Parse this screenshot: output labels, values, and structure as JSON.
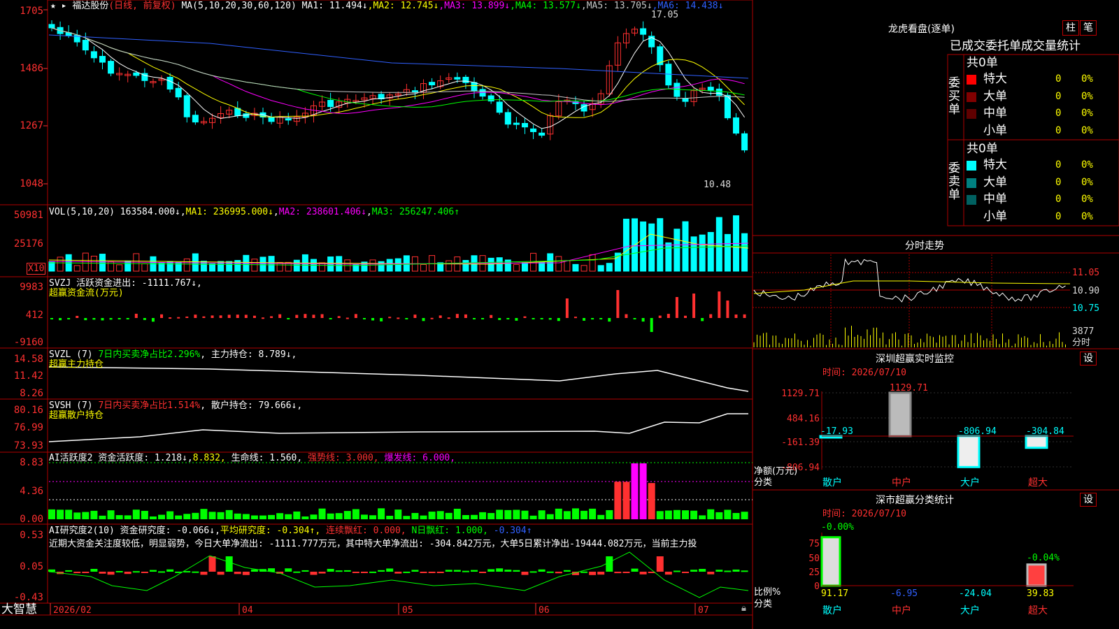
{
  "app": {
    "logo": "大智慧"
  },
  "main": {
    "stock": "福达股份",
    "period": "(日线, 前复权)",
    "ma_label": "MA(5,10,20,30,60,120)",
    "ma": [
      {
        "name": "MA1:",
        "value": "11.494↓",
        "color": "#ffffff"
      },
      {
        "name": "MA2:",
        "value": "12.745↓",
        "color": "#ffff00"
      },
      {
        "name": "MA3:",
        "value": "13.899↓",
        "color": "#ff00ff"
      },
      {
        "name": "MA4:",
        "value": "13.577↓",
        "color": "#00ff00"
      },
      {
        "name": "MA5:",
        "value": "13.705↓",
        "color": "#c8c8c8"
      },
      {
        "name": "MA6:",
        "value": "14.438↓",
        "color": "#3060ff"
      }
    ],
    "y_ticks": [
      "1705",
      "1486",
      "1267",
      "1048"
    ],
    "high_label": "17.05",
    "low_label": "10.48"
  },
  "volume": {
    "label": "VOL(5,10,20)",
    "value": "163584.000↓",
    "ma": [
      {
        "text": "MA1: 236995.000↓",
        "color": "#ffff00"
      },
      {
        "text": "MA2: 238601.406↓",
        "color": "#ff00ff"
      },
      {
        "text": "MA3: 256247.406↑",
        "color": "#00ff00"
      }
    ],
    "y_ticks": [
      "50981",
      "25176"
    ],
    "unit": "X10"
  },
  "svzj": {
    "title": "SVZJ  活跃资金进出: -1111.767↓,",
    "sub": "超赢资金流(万元)",
    "y_ticks": [
      "9983",
      "412",
      "-9160"
    ]
  },
  "svzl": {
    "title": "SVZL (7)",
    "ratio": "7日内买卖净占比2.296%",
    "hold": "主力持仓: 8.789↓,",
    "sub": "超赢主力持仓",
    "y_ticks": [
      "14.58",
      "11.42",
      "8.26"
    ]
  },
  "svsh": {
    "title": "SVSH (7)",
    "ratio": "7日内买卖净占比1.514%",
    "hold": "散户持仓: 79.666↓,",
    "sub": "超赢散户持仓",
    "y_ticks": [
      "80.16",
      "76.99",
      "73.93"
    ]
  },
  "ai1": {
    "title": "AI活跃度2",
    "p1": "资金活跃度: 1.218↓,",
    "p2": "8.832,",
    "p3": "生命线: 1.560,",
    "p4": "强势线: 3.000,",
    "p5": "爆发线: 6.000,",
    "y_ticks": [
      "8.83",
      "4.36",
      "0.00"
    ]
  },
  "ai2": {
    "title": "AI研究度2(10)",
    "p1": "资金研究度: -0.066↓,",
    "p2": "平均研究度: -0.304↑,",
    "p3": "连续飘红: 0.000,",
    "p4": "N日飘红: 1.000,",
    "p5": "-0.304↑",
    "comment": "近期大资金关注度较低，明显弱势，今日大单净流出: -1111.777万元，其中特大单净流出: -304.842万元，大单5日累计净出-19444.082万元，当前主力投",
    "y_ticks": [
      "0.53",
      "0.05",
      "-0.43"
    ]
  },
  "xaxis": [
    "2026/02",
    "04",
    "05",
    "06",
    "07"
  ],
  "dragon": {
    "title": "龙虎看盘(逐单)",
    "btn1": "柱",
    "btn2": "笔",
    "header": "已成交委托单成交量统计",
    "buy": {
      "label": "委买单",
      "total": "共0单",
      "rows": [
        {
          "name": "特大",
          "n": "0",
          "p": "0%"
        },
        {
          "name": "大单",
          "n": "0",
          "p": "0%"
        },
        {
          "name": "中单",
          "n": "0",
          "p": "0%"
        },
        {
          "name": "小单",
          "n": "0",
          "p": "0%"
        }
      ]
    },
    "sell": {
      "label": "委卖单",
      "total": "共0单",
      "rows": [
        {
          "name": "特大",
          "n": "0",
          "p": "0%"
        },
        {
          "name": "大单",
          "n": "0",
          "p": "0%"
        },
        {
          "name": "中单",
          "n": "0",
          "p": "0%"
        },
        {
          "name": "小单",
          "n": "0",
          "p": "0%"
        }
      ]
    }
  },
  "intraday": {
    "title": "分时走势",
    "y_ticks": [
      "11.05",
      "10.90",
      "10.75"
    ],
    "vol": "3877",
    "vol_unit": "分时"
  },
  "monitor": {
    "title": "深圳超赢实时监控",
    "btn": "设",
    "time": "时间: 2026/07/10",
    "y_ticks": [
      "1129.71",
      "484.16",
      "-161.39",
      "-806.94"
    ],
    "ylabel": "净额(万元)",
    "xlabel": "分类",
    "cats": [
      "散户",
      "中户",
      "大户",
      "超大"
    ],
    "values": [
      -17.93,
      1129.71,
      -806.94,
      -304.84
    ],
    "labels": [
      "-17.93",
      "1129.71",
      "-806.94",
      "-304.84"
    ]
  },
  "classify": {
    "title": "深市超赢分类统计",
    "btn": "设",
    "time": "时间: 2026/07/10",
    "y_ticks": [
      "75",
      "50",
      "25",
      "0"
    ],
    "ylabel": "比例%",
    "xlabel": "分类",
    "cats": [
      "散户",
      "中户",
      "大户",
      "超大"
    ],
    "values": [
      91.17,
      -6.95,
      -24.04,
      39.83
    ],
    "labels": [
      "91.17",
      "-6.95",
      "-24.04",
      "39.83"
    ],
    "top_labels": [
      "-0.00%",
      "",
      "",
      "-0.04%"
    ]
  }
}
